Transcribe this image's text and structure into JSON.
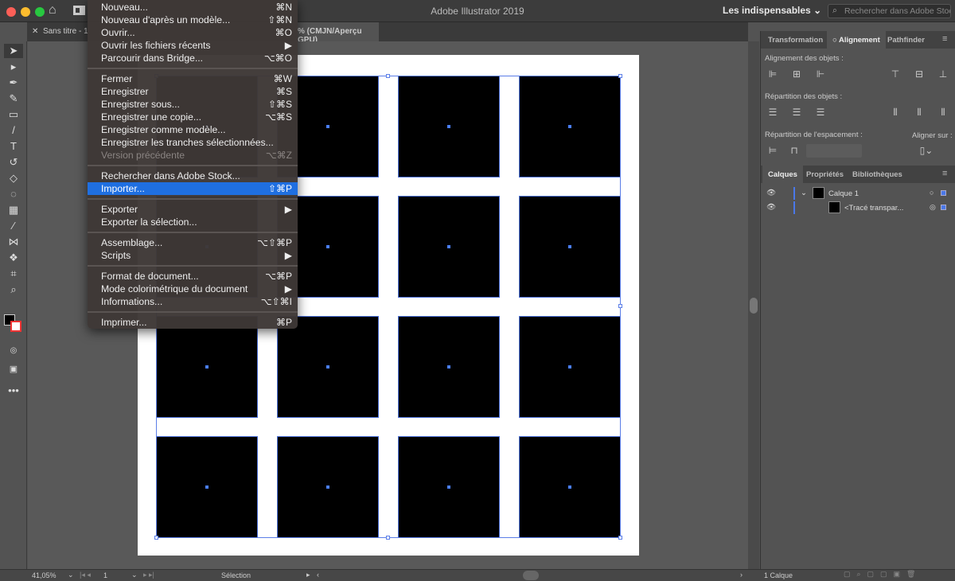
{
  "window": {
    "title": "Adobe Illustrator 2019",
    "workspace": "Les indispensables",
    "search_placeholder": "Rechercher dans Adobe Stock",
    "colors": {
      "close": "#fc5f57",
      "minimize": "#fdbc2e",
      "zoom": "#28c840",
      "accent": "#1f6fe0",
      "selection": "#5b7ee8"
    }
  },
  "tabs": {
    "doc1": "Sans titre - 1",
    "doc2_suffix": "% (CMJN/Aperçu GPU)"
  },
  "menu": {
    "groups": [
      [
        {
          "label": "Nouveau...",
          "shortcut": "⌘N"
        },
        {
          "label": "Nouveau d'après un modèle...",
          "shortcut": "⇧⌘N"
        },
        {
          "label": "Ouvrir...",
          "shortcut": "⌘O"
        },
        {
          "label": "Ouvrir les fichiers récents",
          "shortcut": "▶"
        },
        {
          "label": "Parcourir dans Bridge...",
          "shortcut": "⌥⌘O"
        }
      ],
      [
        {
          "label": "Fermer",
          "shortcut": "⌘W"
        },
        {
          "label": "Enregistrer",
          "shortcut": "⌘S"
        },
        {
          "label": "Enregistrer sous...",
          "shortcut": "⇧⌘S"
        },
        {
          "label": "Enregistrer une copie...",
          "shortcut": "⌥⌘S"
        },
        {
          "label": "Enregistrer comme modèle...",
          "shortcut": ""
        },
        {
          "label": "Enregistrer les tranches sélectionnées...",
          "shortcut": ""
        },
        {
          "label": "Version précédente",
          "shortcut": "⌥⌘Z",
          "disabled": true
        }
      ],
      [
        {
          "label": "Rechercher dans Adobe Stock...",
          "shortcut": ""
        },
        {
          "label": "Importer...",
          "shortcut": "⇧⌘P",
          "highlighted": true
        }
      ],
      [
        {
          "label": "Exporter",
          "shortcut": "▶"
        },
        {
          "label": "Exporter la sélection...",
          "shortcut": ""
        }
      ],
      [
        {
          "label": "Assemblage...",
          "shortcut": "⌥⇧⌘P"
        },
        {
          "label": "Scripts",
          "shortcut": "▶"
        }
      ],
      [
        {
          "label": "Format de document...",
          "shortcut": "⌥⌘P"
        },
        {
          "label": "Mode colorimétrique du document",
          "shortcut": "▶"
        },
        {
          "label": "Informations...",
          "shortcut": "⌥⇧⌘I"
        }
      ],
      [
        {
          "label": "Imprimer...",
          "shortcut": "⌘P"
        }
      ]
    ]
  },
  "panels": {
    "top_tabs": [
      "Transformation",
      "Alignement",
      "Pathfinder"
    ],
    "align_objects": "Alignement des objets :",
    "distribute_objects": "Répartition des objets :",
    "distribute_spacing": "Répartition de l'espacement :",
    "align_to": "Aligner sur :",
    "bottom_tabs": [
      "Calques",
      "Propriétés",
      "Bibliothèques"
    ],
    "layers": [
      {
        "name": "Calque 1"
      },
      {
        "name": "<Tracé transpar..."
      }
    ],
    "layer_count": "1 Calque"
  },
  "status": {
    "zoom": "41,05%",
    "page": "1",
    "tool": "Sélection"
  }
}
